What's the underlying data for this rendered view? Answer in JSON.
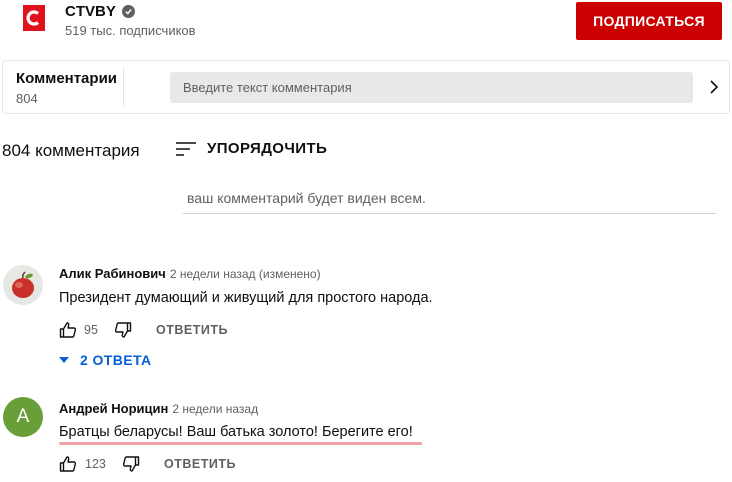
{
  "channel": {
    "logo_letter": "C",
    "name": "CTVBY",
    "verified_icon": "check-circle-icon",
    "subscribers": "519 тыс. подписчиков",
    "subscribe_label": "ПОДПИСАТЬСЯ",
    "accent_color": "#cc0000"
  },
  "comments_panel": {
    "title": "Комментарии",
    "count": "804",
    "input_placeholder": "Введите текст комментария",
    "chevron_icon": "chevron-right-icon"
  },
  "sort_bar": {
    "count_label": "804 комментария",
    "sort_icon": "sort-icon",
    "sort_label": "УПОРЯДОЧИТЬ"
  },
  "add_comment": {
    "placeholder": "ваш комментарий будет виден всем."
  },
  "comments": [
    {
      "author": "Алик Рабинович",
      "meta": "2 недели назад (изменено)",
      "text": "Президент думающий и живущий для простого народа.",
      "likes": "95",
      "reply_label": "ОТВЕТИТЬ",
      "replies_label": "2 ОТВЕТА",
      "avatar_icon": "apple-avatar-icon"
    },
    {
      "author": "Андрей Норицин",
      "meta": "2 недели назад",
      "text": "Братцы беларусы! Ваш батька золото! Берегите его!",
      "likes": "123",
      "reply_label": "ОТВЕТИТЬ",
      "avatar_letter": "А",
      "avatar_color": "#689f38"
    }
  ]
}
